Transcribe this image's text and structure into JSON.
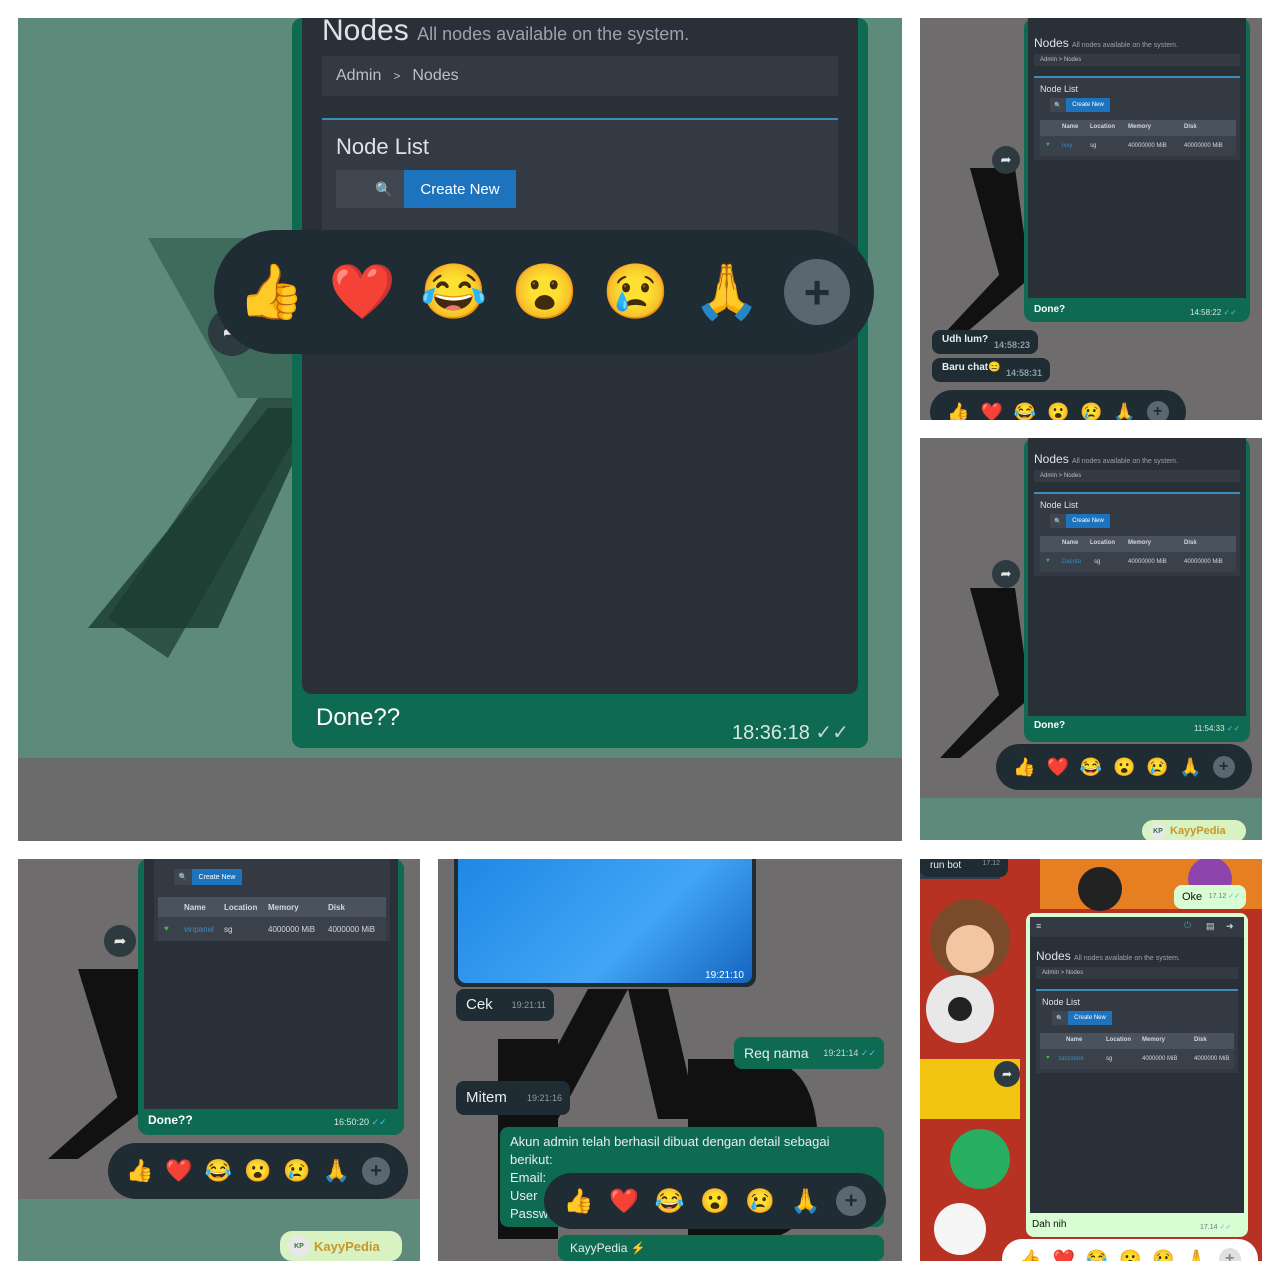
{
  "common": {
    "page_title": "Nodes",
    "page_subtitle": "All nodes available on the system.",
    "crumb_admin": "Admin",
    "crumb_sep": ">",
    "crumb_nodes": "Nodes",
    "card_title": "Node List",
    "create_label": "Create New",
    "search_icon": "🔍",
    "columns": [
      "Name",
      "Location",
      "Memory",
      "Disk"
    ],
    "reactions": [
      "👍",
      "❤️",
      "😂",
      "😮",
      "😢",
      "🙏"
    ],
    "plus": "+",
    "forward_icon": "➦",
    "ticks": "✓✓"
  },
  "p1": {
    "done": "Done??",
    "time": "18:36:18"
  },
  "p2": {
    "done": "Done?",
    "time": "14:58:22",
    "row": {
      "name": "ixxy",
      "location": "sg",
      "memory": "40000000 MiB",
      "disk": "40000000 MiB"
    },
    "msg1": {
      "text": "Udh lum?",
      "time": "14:58:23"
    },
    "msg2": {
      "text": "Baru chat😑",
      "time": "14:58:31"
    }
  },
  "p3": {
    "done": "Done?",
    "time": "11:54:33",
    "row": {
      "name": "Dacota",
      "location": "sg",
      "memory": "40000000 MiB",
      "disk": "40000000 MiB"
    },
    "brand": "KayyPedia"
  },
  "p4": {
    "done": "Done??",
    "time": "16:50:20",
    "row": {
      "name": "vinpanel",
      "location": "sg",
      "memory": "4000000 MiB",
      "disk": "4000000 MiB"
    },
    "brand": "KayyPedia"
  },
  "p5": {
    "img_time": "19:21:10",
    "cek": {
      "text": "Cek",
      "time": "19:21:11"
    },
    "req": {
      "text": "Req nama",
      "time": "19:21:14"
    },
    "mitem": {
      "text": "Mitem",
      "time": "19:21:16"
    },
    "admin_lines": [
      "Akun admin telah berhasil dibuat dengan detail sebagai",
      "berikut:",
      "Email:",
      "User",
      "Passw"
    ],
    "brand": "KayyPedia ⚡"
  },
  "p6": {
    "runbot": {
      "text": "run bot",
      "time": "17.12"
    },
    "oke": {
      "text": "Oke",
      "time": "17.12"
    },
    "row": {
      "name": "zaxzstore",
      "location": "sg",
      "memory": "4000000 MiB",
      "disk": "4000000 MiB"
    },
    "done": "Dah nih",
    "time": "17.14"
  },
  "colors": {
    "chat_green": "#0e6b52",
    "panel_dark": "#2a3038",
    "accent_blue": "#1e73be",
    "bg_green": "#5d8a7a",
    "bg_grey": "#6e6c6c"
  }
}
